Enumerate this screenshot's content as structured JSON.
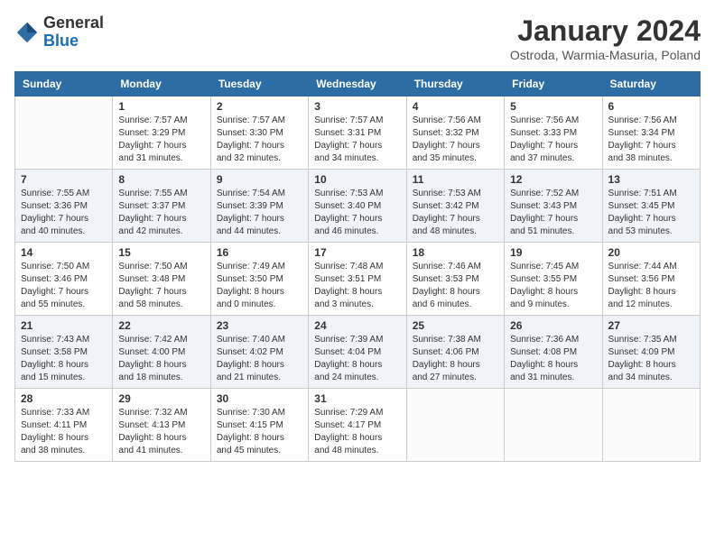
{
  "logo": {
    "general": "General",
    "blue": "Blue"
  },
  "title": {
    "month_year": "January 2024",
    "location": "Ostroda, Warmia-Masuria, Poland"
  },
  "calendar": {
    "headers": [
      "Sunday",
      "Monday",
      "Tuesday",
      "Wednesday",
      "Thursday",
      "Friday",
      "Saturday"
    ],
    "weeks": [
      [
        {
          "day": "",
          "info": ""
        },
        {
          "day": "1",
          "info": "Sunrise: 7:57 AM\nSunset: 3:29 PM\nDaylight: 7 hours\nand 31 minutes."
        },
        {
          "day": "2",
          "info": "Sunrise: 7:57 AM\nSunset: 3:30 PM\nDaylight: 7 hours\nand 32 minutes."
        },
        {
          "day": "3",
          "info": "Sunrise: 7:57 AM\nSunset: 3:31 PM\nDaylight: 7 hours\nand 34 minutes."
        },
        {
          "day": "4",
          "info": "Sunrise: 7:56 AM\nSunset: 3:32 PM\nDaylight: 7 hours\nand 35 minutes."
        },
        {
          "day": "5",
          "info": "Sunrise: 7:56 AM\nSunset: 3:33 PM\nDaylight: 7 hours\nand 37 minutes."
        },
        {
          "day": "6",
          "info": "Sunrise: 7:56 AM\nSunset: 3:34 PM\nDaylight: 7 hours\nand 38 minutes."
        }
      ],
      [
        {
          "day": "7",
          "info": "Sunrise: 7:55 AM\nSunset: 3:36 PM\nDaylight: 7 hours\nand 40 minutes."
        },
        {
          "day": "8",
          "info": "Sunrise: 7:55 AM\nSunset: 3:37 PM\nDaylight: 7 hours\nand 42 minutes."
        },
        {
          "day": "9",
          "info": "Sunrise: 7:54 AM\nSunset: 3:39 PM\nDaylight: 7 hours\nand 44 minutes."
        },
        {
          "day": "10",
          "info": "Sunrise: 7:53 AM\nSunset: 3:40 PM\nDaylight: 7 hours\nand 46 minutes."
        },
        {
          "day": "11",
          "info": "Sunrise: 7:53 AM\nSunset: 3:42 PM\nDaylight: 7 hours\nand 48 minutes."
        },
        {
          "day": "12",
          "info": "Sunrise: 7:52 AM\nSunset: 3:43 PM\nDaylight: 7 hours\nand 51 minutes."
        },
        {
          "day": "13",
          "info": "Sunrise: 7:51 AM\nSunset: 3:45 PM\nDaylight: 7 hours\nand 53 minutes."
        }
      ],
      [
        {
          "day": "14",
          "info": "Sunrise: 7:50 AM\nSunset: 3:46 PM\nDaylight: 7 hours\nand 55 minutes."
        },
        {
          "day": "15",
          "info": "Sunrise: 7:50 AM\nSunset: 3:48 PM\nDaylight: 7 hours\nand 58 minutes."
        },
        {
          "day": "16",
          "info": "Sunrise: 7:49 AM\nSunset: 3:50 PM\nDaylight: 8 hours\nand 0 minutes."
        },
        {
          "day": "17",
          "info": "Sunrise: 7:48 AM\nSunset: 3:51 PM\nDaylight: 8 hours\nand 3 minutes."
        },
        {
          "day": "18",
          "info": "Sunrise: 7:46 AM\nSunset: 3:53 PM\nDaylight: 8 hours\nand 6 minutes."
        },
        {
          "day": "19",
          "info": "Sunrise: 7:45 AM\nSunset: 3:55 PM\nDaylight: 8 hours\nand 9 minutes."
        },
        {
          "day": "20",
          "info": "Sunrise: 7:44 AM\nSunset: 3:56 PM\nDaylight: 8 hours\nand 12 minutes."
        }
      ],
      [
        {
          "day": "21",
          "info": "Sunrise: 7:43 AM\nSunset: 3:58 PM\nDaylight: 8 hours\nand 15 minutes."
        },
        {
          "day": "22",
          "info": "Sunrise: 7:42 AM\nSunset: 4:00 PM\nDaylight: 8 hours\nand 18 minutes."
        },
        {
          "day": "23",
          "info": "Sunrise: 7:40 AM\nSunset: 4:02 PM\nDaylight: 8 hours\nand 21 minutes."
        },
        {
          "day": "24",
          "info": "Sunrise: 7:39 AM\nSunset: 4:04 PM\nDaylight: 8 hours\nand 24 minutes."
        },
        {
          "day": "25",
          "info": "Sunrise: 7:38 AM\nSunset: 4:06 PM\nDaylight: 8 hours\nand 27 minutes."
        },
        {
          "day": "26",
          "info": "Sunrise: 7:36 AM\nSunset: 4:08 PM\nDaylight: 8 hours\nand 31 minutes."
        },
        {
          "day": "27",
          "info": "Sunrise: 7:35 AM\nSunset: 4:09 PM\nDaylight: 8 hours\nand 34 minutes."
        }
      ],
      [
        {
          "day": "28",
          "info": "Sunrise: 7:33 AM\nSunset: 4:11 PM\nDaylight: 8 hours\nand 38 minutes."
        },
        {
          "day": "29",
          "info": "Sunrise: 7:32 AM\nSunset: 4:13 PM\nDaylight: 8 hours\nand 41 minutes."
        },
        {
          "day": "30",
          "info": "Sunrise: 7:30 AM\nSunset: 4:15 PM\nDaylight: 8 hours\nand 45 minutes."
        },
        {
          "day": "31",
          "info": "Sunrise: 7:29 AM\nSunset: 4:17 PM\nDaylight: 8 hours\nand 48 minutes."
        },
        {
          "day": "",
          "info": ""
        },
        {
          "day": "",
          "info": ""
        },
        {
          "day": "",
          "info": ""
        }
      ]
    ]
  }
}
